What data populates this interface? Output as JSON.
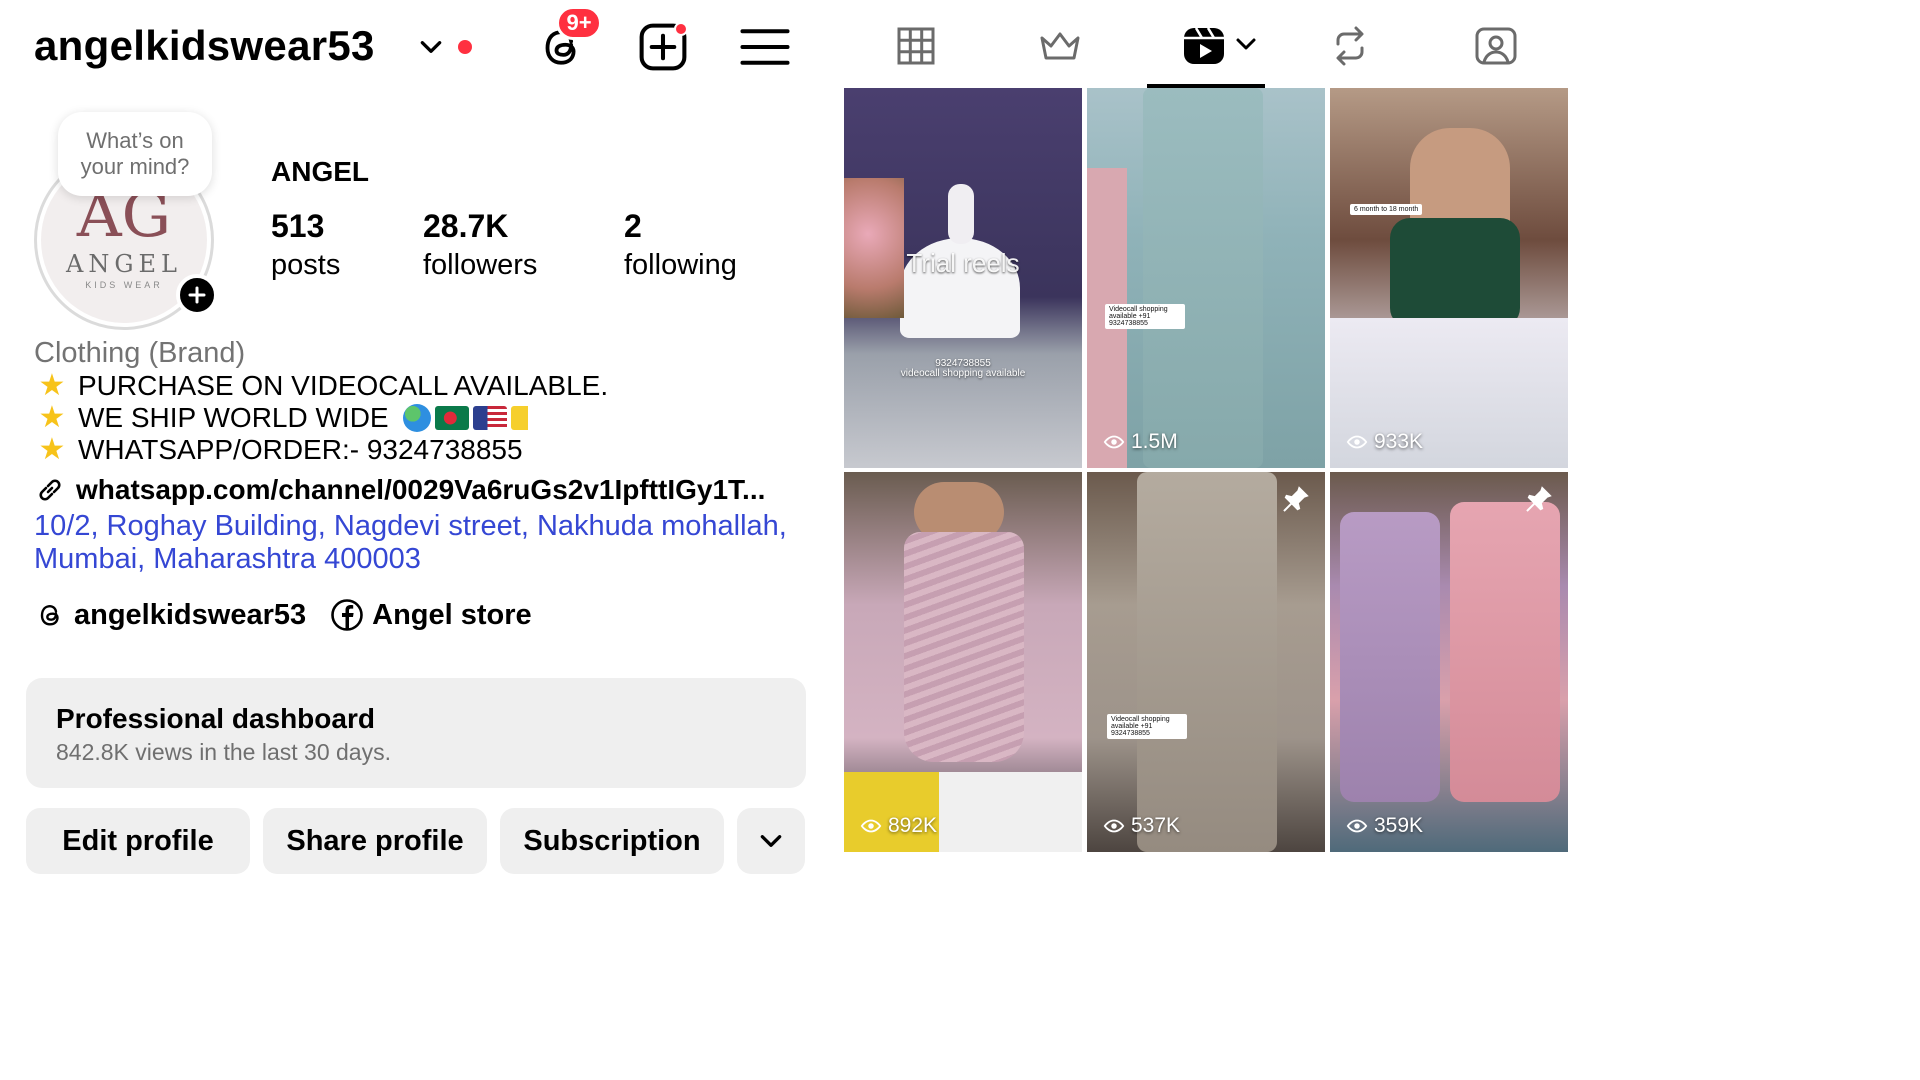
{
  "header": {
    "username": "angelkidswear53",
    "threads_badge": "9+"
  },
  "profile": {
    "note": "What’s on your mind?",
    "avatar_monogram": "AG",
    "avatar_name": "ANGEL",
    "avatar_sub": "KIDS WEAR",
    "display_name": "ANGEL",
    "stats": [
      {
        "value": "513",
        "label": "posts"
      },
      {
        "value": "28.7K",
        "label": "followers"
      },
      {
        "value": "2",
        "label": "following"
      }
    ]
  },
  "bio": {
    "category": "Clothing (Brand)",
    "lines": [
      "PURCHASE ON VIDEOCALL AVAILABLE.",
      "WE SHIP WORLD WIDE",
      "WHATSAPP/ORDER:- 9324738855"
    ],
    "link": "whatsapp.com/channel/0029Va6ruGs2v1IpfttIGy1T...",
    "address": "10/2, Roghay Building, Nagdevi street, Nakhuda mohallah, Mumbai, Maharashtra 400003"
  },
  "socials": {
    "threads": "angelkidswear53",
    "facebook": "Angel store"
  },
  "dashboard": {
    "title": "Professional dashboard",
    "subtitle": "842.8K views in the last 30 days."
  },
  "buttons": {
    "edit": "Edit profile",
    "share": "Share profile",
    "subscription": "Subscription"
  },
  "tiles": [
    {
      "overlay_title": "Trial reels",
      "overlay_phone": "9324738855",
      "overlay_caption": "videocall shopping available"
    },
    {
      "views": "1.5M",
      "tag": "Videocall shopping available +91 9324738855"
    },
    {
      "views": "933K",
      "tag": "6 month to 18 month"
    },
    {
      "views": "892K"
    },
    {
      "views": "537K",
      "tag": "Videocall shopping available +91 9324738855"
    },
    {
      "views": "359K"
    }
  ],
  "colors": {
    "notification_red": "#ff3040",
    "link_blue": "#3547d4",
    "muted_gray": "#737373",
    "button_bg": "#efefef"
  }
}
